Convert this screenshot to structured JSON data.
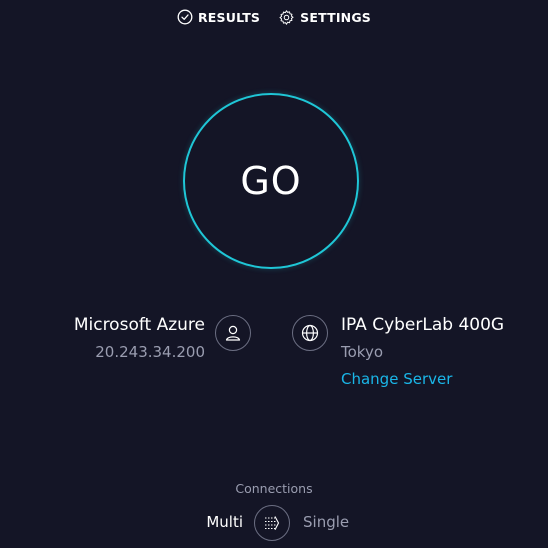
{
  "nav": {
    "results_label": "RESULTS",
    "settings_label": "SETTINGS",
    "results_icon": "check-circle-icon",
    "settings_icon": "gear-icon"
  },
  "go_button": {
    "label": "GO"
  },
  "isp": {
    "name": "Microsoft Azure",
    "ip": "20.243.34.200",
    "icon": "user-icon"
  },
  "server": {
    "name": "IPA CyberLab 400G",
    "location": "Tokyo",
    "change_label": "Change Server",
    "icon": "globe-icon"
  },
  "connections": {
    "label": "Connections",
    "multi_label": "Multi",
    "single_label": "Single",
    "selected": "Multi",
    "icon": "connections-toggle-icon"
  },
  "colors": {
    "background": "#141526",
    "accent_ring": "#1fc6d6",
    "link": "#1ab6e8",
    "muted_text": "#9a9db0",
    "icon_border": "#6b6e82"
  }
}
